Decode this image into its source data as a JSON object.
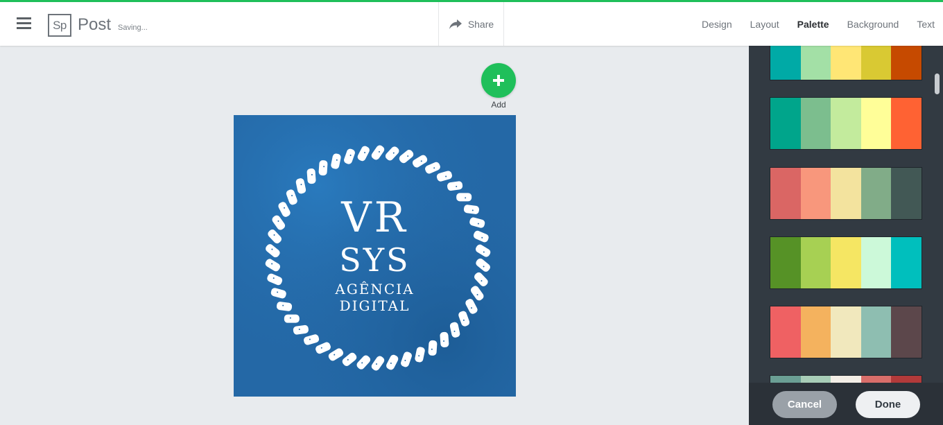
{
  "header": {
    "logo_text": "Sp",
    "app_name": "Post",
    "status": "Saving...",
    "share_label": "Share",
    "tabs": [
      {
        "label": "Design"
      },
      {
        "label": "Layout"
      },
      {
        "label": "Palette",
        "active": true
      },
      {
        "label": "Background"
      },
      {
        "label": "Text"
      }
    ]
  },
  "add": {
    "label": "Add"
  },
  "canvas": {
    "line1": "VR",
    "line2": "SYS",
    "line3": "AGÊNCIA",
    "line4": "DIGITAL",
    "background_color": "#2468a6"
  },
  "palettes": [
    [
      "#00aaa6",
      "#a3e0a6",
      "#ffe675",
      "#d9c933",
      "#c64a00"
    ],
    [
      "#00a58b",
      "#7cbe8e",
      "#c3eb9d",
      "#fffe98",
      "#ff6233"
    ],
    [
      "#da6664",
      "#f8977c",
      "#f3e39e",
      "#81ac88",
      "#425855"
    ],
    [
      "#569226",
      "#a7d053",
      "#f5e663",
      "#ccf9d9",
      "#00bfbd"
    ],
    [
      "#ef6163",
      "#f4b25e",
      "#f1e8bd",
      "#8ebeb1",
      "#5c474b"
    ],
    [
      "#6b9f94",
      "#a8cdb7",
      "#f3eee6",
      "#d96e6a",
      "#b23a3a"
    ]
  ],
  "footer": {
    "cancel_label": "Cancel",
    "done_label": "Done"
  },
  "colors": {
    "accent": "#1fbf5a",
    "panel": "#323a42"
  }
}
